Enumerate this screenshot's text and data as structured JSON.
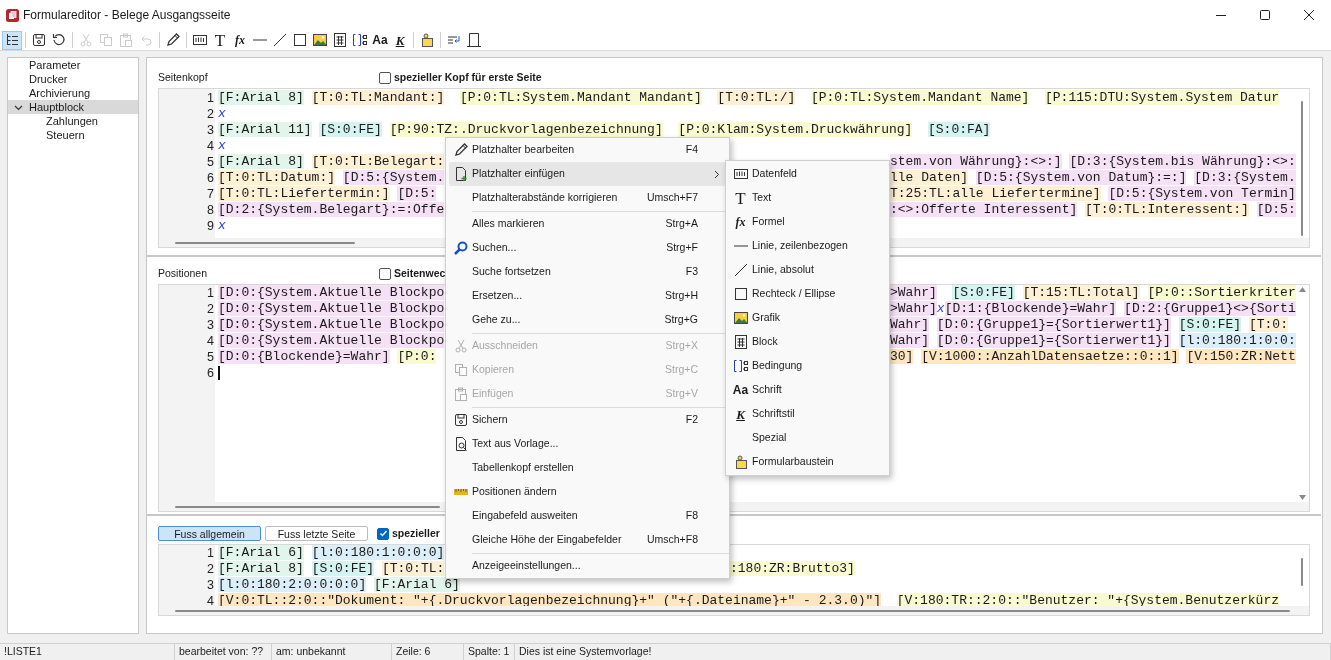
{
  "window": {
    "title": "Formulareditor - Belege Ausgangsseite"
  },
  "toolbar": [
    [
      {
        "selected": true,
        "disabled": false
      }
    ],
    [
      {
        "selected": false,
        "disabled": false
      },
      {
        "selected": false,
        "disabled": false
      }
    ],
    [
      {
        "selected": false,
        "disabled": true
      },
      {
        "selected": false,
        "disabled": true
      },
      {
        "selected": false,
        "disabled": true
      },
      {
        "selected": false,
        "disabled": true
      }
    ],
    [
      {
        "selected": false,
        "disabled": false
      }
    ],
    [
      {
        "selected": false,
        "disabled": false
      },
      {
        "selected": false,
        "disabled": false,
        "glyph": "T"
      },
      {
        "selected": false,
        "disabled": false,
        "glyph": "fx"
      },
      {
        "selected": false,
        "disabled": false
      },
      {
        "selected": false,
        "disabled": false
      },
      {
        "selected": false,
        "disabled": false
      },
      {
        "selected": false,
        "disabled": false
      },
      {
        "selected": false,
        "disabled": false
      },
      {
        "selected": false,
        "disabled": false
      },
      {
        "selected": false,
        "disabled": false,
        "glyph": "Aa"
      },
      {
        "selected": false,
        "disabled": false,
        "glyph": "K"
      }
    ],
    [
      {
        "selected": false,
        "disabled": false
      }
    ],
    [
      {
        "selected": false,
        "disabled": false
      },
      {
        "selected": false,
        "disabled": false
      }
    ]
  ],
  "tree": [
    {
      "label": "Parameter",
      "selected": false
    },
    {
      "label": "Drucker",
      "selected": false
    },
    {
      "label": "Archivierung",
      "selected": false
    },
    {
      "label": "Hauptblock",
      "selected": true,
      "expanded": true,
      "children": [
        {
          "label": "Zahlungen",
          "selected": false
        },
        {
          "label": "Steuern",
          "selected": false
        }
      ]
    }
  ],
  "header": {
    "label": "Seitenkopf",
    "checkbox": {
      "label": "spezieller Kopf für erste Seite",
      "checked": false
    },
    "lines": [
      {
        "number": "1",
        "cursor": false,
        "left": [
          {
            "kind": "font",
            "text": "[F:Arial 8] "
          },
          {
            "kind": "text",
            "text": "[T:0:TL:Mandant:]  "
          },
          {
            "kind": "param",
            "text": "[P:0:TL:System.Mandant Mandant]  "
          },
          {
            "kind": "text",
            "text": "[T:0:TL:/]  "
          },
          {
            "kind": "param",
            "text": "[P:0:TL:System.Mandant Name]  "
          },
          {
            "kind": "param",
            "text": "[P:115:DTU:System.System Datur"
          }
        ]
      },
      {
        "number": "2",
        "cursor": false,
        "left": [
          {
            "kind": "break",
            "text": "x"
          }
        ]
      },
      {
        "number": "3",
        "cursor": false,
        "left": [
          {
            "kind": "font",
            "text": "[F:Arial 11] "
          },
          {
            "kind": "sys",
            "text": "[S:0:FE] "
          },
          {
            "kind": "param",
            "text": "[P:90:TZ:.Druckvorlagenbezeichnung]  "
          },
          {
            "kind": "param",
            "text": "[P:0:Klam:System.Druckwährung]  "
          },
          {
            "kind": "sys",
            "text": "[S:0:FA]"
          }
        ]
      },
      {
        "number": "4",
        "cursor": false,
        "left": [
          {
            "kind": "break",
            "text": "x"
          }
        ]
      },
      {
        "number": "5",
        "cursor": false,
        "left": [
          {
            "kind": "font",
            "text": "[F:Arial 8] "
          },
          {
            "kind": "text",
            "text": "[T:0:TL:Belegart:"
          }
        ],
        "right": [
          {
            "kind": "data",
            "text": "stem.von Währung}:<>:] "
          },
          {
            "kind": "data",
            "text": "[D:3:{System.bis Währung}:<>:"
          }
        ]
      },
      {
        "number": "6",
        "cursor": false,
        "left": [
          {
            "kind": "text",
            "text": "[T:0:TL:Datum:] "
          },
          {
            "kind": "data",
            "text": "[D:5:{System."
          }
        ],
        "right": [
          {
            "kind": "text",
            "text": "lle Daten] "
          },
          {
            "kind": "data",
            "text": "[D:5:{System.von Datum}:=:] "
          },
          {
            "kind": "data",
            "text": "[D:3:{System."
          }
        ]
      },
      {
        "number": "7",
        "cursor": false,
        "left": [
          {
            "kind": "text",
            "text": "[T:0:TL:Liefertermin:] "
          },
          {
            "kind": "data",
            "text": "[D:5:"
          }
        ],
        "right": [
          {
            "kind": "text",
            "text": "T:25:TL:alle Liefertermine] "
          },
          {
            "kind": "data",
            "text": "[D:5:{System.von Termin]"
          }
        ]
      },
      {
        "number": "8",
        "cursor": false,
        "left": [
          {
            "kind": "data",
            "text": "[D:2:{System.Belegart}:=:Offe"
          }
        ],
        "right": [
          {
            "kind": "data",
            "text": ":<>:Offerte Interessent] "
          },
          {
            "kind": "text",
            "text": "[T:0:TL:Interessent:] "
          },
          {
            "kind": "data",
            "text": "[D:5:"
          }
        ]
      },
      {
        "number": "9",
        "cursor": false,
        "left": [
          {
            "kind": "break",
            "text": "x"
          }
        ]
      }
    ]
  },
  "positions": {
    "label": "Positionen",
    "checkbox": {
      "label": "Seitenwec",
      "checked": false
    },
    "lines": [
      {
        "number": "1",
        "cursor": false,
        "left": [
          {
            "kind": "data",
            "text": "[D:0:{System.Aktuelle Blockpo"
          }
        ],
        "right": [
          {
            "kind": "data",
            "text": ">Wahr]  "
          },
          {
            "kind": "sys",
            "text": "[S:0:FE] "
          },
          {
            "kind": "text",
            "text": "[T:15:TL:Total] "
          },
          {
            "kind": "param",
            "text": "[P:0::Sortierkriter"
          }
        ]
      },
      {
        "number": "2",
        "cursor": false,
        "left": [
          {
            "kind": "data",
            "text": "[D:0:{System.Aktuelle Blockpo"
          }
        ],
        "right": [
          {
            "kind": "data",
            "text": ">Wahr]"
          },
          {
            "kind": "break",
            "text": "x"
          },
          {
            "kind": "data",
            "text": "[D:1:{Blockende}=Wahr] "
          },
          {
            "kind": "data",
            "text": "[D:2:{Gruppe1}<>{Sorti"
          }
        ]
      },
      {
        "number": "3",
        "cursor": false,
        "left": [
          {
            "kind": "data",
            "text": "[D:0:{System.Aktuelle Blockpo"
          }
        ],
        "right": [
          {
            "kind": "data",
            "text": "Wahr] "
          },
          {
            "kind": "data",
            "text": "[D:0:{Gruppe1}={Sortierwert1}] "
          },
          {
            "kind": "sys",
            "text": "[S:0:FE] "
          },
          {
            "kind": "text",
            "text": "[T:0:"
          }
        ]
      },
      {
        "number": "4",
        "cursor": false,
        "left": [
          {
            "kind": "data",
            "text": "[D:0:{System.Aktuelle Blockpo"
          }
        ],
        "right": [
          {
            "kind": "data",
            "text": "Wahr] "
          },
          {
            "kind": "data",
            "text": "[D:0:{Gruppe1}={Sortierwert1}] "
          },
          {
            "kind": "line",
            "text": "[l:0:180:1:0:0:"
          }
        ]
      },
      {
        "number": "5",
        "cursor": false,
        "left": [
          {
            "kind": "data",
            "text": "[D:0:{Blockende}=Wahr] "
          },
          {
            "kind": "param",
            "text": "[P:0:"
          }
        ],
        "right": [
          {
            "kind": "var",
            "text": "30] "
          },
          {
            "kind": "var",
            "text": "[V:1000::AnzahlDatensaetze::0::1] "
          },
          {
            "kind": "var",
            "text": "[V:150:ZR:Nett"
          }
        ]
      },
      {
        "number": "6",
        "cursor": true
      }
    ]
  },
  "footer": {
    "tabs": [
      {
        "label": "Fuss allgemein",
        "selected": true
      },
      {
        "label": "Fuss letzte Seite",
        "selected": false
      }
    ],
    "checkbox": {
      "label": "spezieller",
      "checked": true
    },
    "lines": [
      {
        "number": "1",
        "cursor": false,
        "left": [
          {
            "kind": "font",
            "text": "[F:Arial 6] "
          },
          {
            "kind": "line",
            "text": "[l:0:180:1:0:0:0]"
          }
        ]
      },
      {
        "number": "2",
        "cursor": false,
        "left": [
          {
            "kind": "font",
            "text": "[F:Arial 8] "
          },
          {
            "kind": "sys",
            "text": "[S:0:FE] "
          },
          {
            "kind": "text",
            "text": "[T:0:TL:"
          }
        ],
        "right": [
          {
            "kind": "param",
            "text": ":180:ZR:Brutto3]"
          }
        ]
      },
      {
        "number": "3",
        "cursor": false,
        "left": [
          {
            "kind": "line",
            "text": "[l:0:180:2:0:0:0:0] "
          },
          {
            "kind": "font",
            "text": "[F:Arial 6]"
          }
        ]
      },
      {
        "number": "4",
        "cursor": false,
        "left": [
          {
            "kind": "var",
            "text": "[V:0:TL::2:0::\"Dokument: \"+{.Druckvorlagenbezeichnung}+\" (\"+{.Dateiname}+\" - 2.3.0)\"]  "
          },
          {
            "kind": "param",
            "text": "[V:180:TR::2:0::\"Benutzer: \"+{System.Benutzerkürz"
          }
        ]
      }
    ]
  },
  "context_menu": {
    "groups": [
      [
        {
          "label": "Platzhalter bearbeiten",
          "shortcut": "F4",
          "disabled": false,
          "selected": false,
          "has_submenu": false
        },
        {
          "label": "Platzhalter einfügen",
          "disabled": false,
          "selected": true,
          "has_submenu": true
        },
        {
          "label": "Platzhalterabstände korrigieren",
          "shortcut": "Umsch+F7",
          "disabled": false,
          "selected": false,
          "has_submenu": false
        }
      ],
      [
        {
          "label": "Alles markieren",
          "shortcut": "Strg+A",
          "disabled": false,
          "selected": false,
          "has_submenu": false
        },
        {
          "label": "Suchen...",
          "shortcut": "Strg+F",
          "disabled": false,
          "selected": false,
          "has_submenu": false
        },
        {
          "label": "Suche fortsetzen",
          "shortcut": "F3",
          "disabled": false,
          "selected": false,
          "has_submenu": false
        },
        {
          "label": "Ersetzen...",
          "shortcut": "Strg+H",
          "disabled": false,
          "selected": false,
          "has_submenu": false
        },
        {
          "label": "Gehe zu...",
          "shortcut": "Strg+G",
          "disabled": false,
          "selected": false,
          "has_submenu": false
        }
      ],
      [
        {
          "label": "Ausschneiden",
          "shortcut": "Strg+X",
          "disabled": true,
          "selected": false,
          "has_submenu": false
        },
        {
          "label": "Kopieren",
          "shortcut": "Strg+C",
          "disabled": true,
          "selected": false,
          "has_submenu": false
        },
        {
          "label": "Einfügen",
          "shortcut": "Strg+V",
          "disabled": true,
          "selected": false,
          "has_submenu": false
        }
      ],
      [
        {
          "label": "Sichern",
          "shortcut": "F2",
          "disabled": false,
          "selected": false,
          "has_submenu": false
        },
        {
          "label": "Text aus Vorlage...",
          "disabled": false,
          "selected": false,
          "has_submenu": false
        },
        {
          "label": "Tabellenkopf erstellen",
          "disabled": false,
          "selected": false,
          "has_submenu": false
        },
        {
          "label": "Positionen ändern",
          "disabled": false,
          "selected": false,
          "has_submenu": false
        },
        {
          "label": "Eingabefeld ausweiten",
          "shortcut": "F8",
          "disabled": false,
          "selected": false,
          "has_submenu": false
        },
        {
          "label": "Gleiche Höhe der Eingabefelder",
          "shortcut": "Umsch+F8",
          "disabled": false,
          "selected": false,
          "has_submenu": false
        }
      ],
      [
        {
          "label": "Anzeigeeinstellungen...",
          "disabled": false,
          "selected": false,
          "has_submenu": false
        }
      ]
    ]
  },
  "submenu": {
    "items": [
      {
        "label": "Datenfeld"
      },
      {
        "label": "Text",
        "glyph": "T"
      },
      {
        "label": "Formel",
        "glyph": "fx"
      },
      {
        "label": "Linie, zeilenbezogen"
      },
      {
        "label": "Linie, absolut"
      },
      {
        "label": "Rechteck / Ellipse"
      },
      {
        "label": "Grafik"
      },
      {
        "label": "Block"
      },
      {
        "label": "Bedingung"
      },
      {
        "label": "Schrift",
        "glyph": "Aa"
      },
      {
        "label": "Schriftstil",
        "glyph": "K"
      },
      {
        "label": "Spezial"
      },
      {
        "label": "Formularbaustein"
      }
    ]
  },
  "status_bar": [
    "!LISTE1",
    "bearbeitet von: ??",
    "am: unbekannt",
    "Zeile: 6",
    "Spalte: 1",
    "Dies ist eine Systemvorlage!"
  ]
}
